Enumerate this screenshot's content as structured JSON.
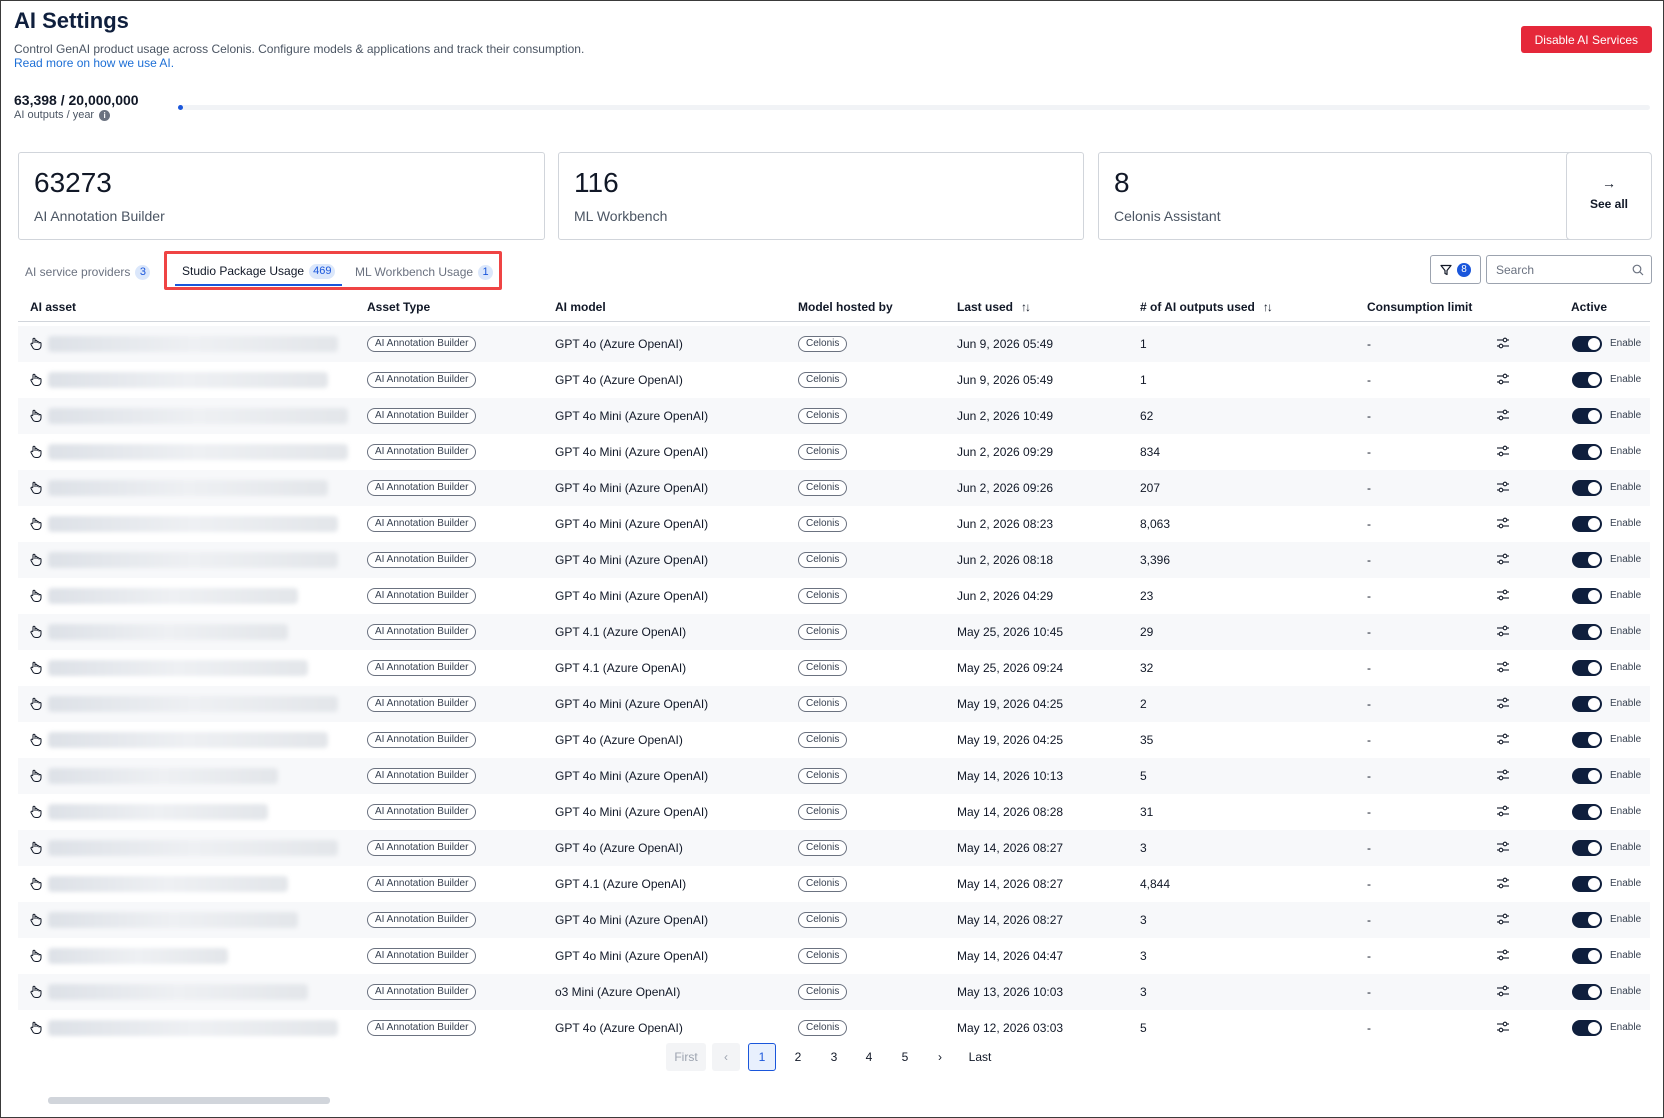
{
  "header": {
    "title": "AI Settings",
    "subtitle": "Control GenAI product usage across Celonis. Configure models & applications and track their consumption.",
    "read_more": "Read more on how we use AI.",
    "disable_button": "Disable AI Services"
  },
  "usage": {
    "count": "63,398 / 20,000,000",
    "label": "AI outputs / year",
    "used_fraction": 0.00317
  },
  "cards": [
    {
      "value": "63273",
      "label": "AI Annotation Builder"
    },
    {
      "value": "116",
      "label": "ML Workbench"
    },
    {
      "value": "8",
      "label": "Celonis Assistant"
    }
  ],
  "see_all": "See all",
  "tabs": [
    {
      "label": "AI service providers",
      "count": "3"
    },
    {
      "label": "Studio Package Usage",
      "count": "469"
    },
    {
      "label": "ML Workbench Usage",
      "count": "1"
    }
  ],
  "filter": {
    "count": "8"
  },
  "search": {
    "placeholder": "Search"
  },
  "columns": {
    "asset": "AI asset",
    "type": "Asset Type",
    "model": "AI model",
    "host": "Model hosted by",
    "last_used": "Last used",
    "outputs": "# of AI outputs used",
    "limit": "Consumption limit",
    "active": "Active"
  },
  "rows": [
    {
      "type": "AI Annotation Builder",
      "model": "GPT 4o (Azure OpenAI)",
      "host": "Celonis",
      "last_used": "Jun 9, 2026 05:49",
      "outputs": "1",
      "limit": "-",
      "status": "Enable"
    },
    {
      "type": "AI Annotation Builder",
      "model": "GPT 4o (Azure OpenAI)",
      "host": "Celonis",
      "last_used": "Jun 9, 2026 05:49",
      "outputs": "1",
      "limit": "-",
      "status": "Enable"
    },
    {
      "type": "AI Annotation Builder",
      "model": "GPT 4o Mini (Azure OpenAI)",
      "host": "Celonis",
      "last_used": "Jun 2, 2026 10:49",
      "outputs": "62",
      "limit": "-",
      "status": "Enable"
    },
    {
      "type": "AI Annotation Builder",
      "model": "GPT 4o Mini (Azure OpenAI)",
      "host": "Celonis",
      "last_used": "Jun 2, 2026 09:29",
      "outputs": "834",
      "limit": "-",
      "status": "Enable"
    },
    {
      "type": "AI Annotation Builder",
      "model": "GPT 4o Mini (Azure OpenAI)",
      "host": "Celonis",
      "last_used": "Jun 2, 2026 09:26",
      "outputs": "207",
      "limit": "-",
      "status": "Enable"
    },
    {
      "type": "AI Annotation Builder",
      "model": "GPT 4o Mini (Azure OpenAI)",
      "host": "Celonis",
      "last_used": "Jun 2, 2026 08:23",
      "outputs": "8,063",
      "limit": "-",
      "status": "Enable"
    },
    {
      "type": "AI Annotation Builder",
      "model": "GPT 4o Mini (Azure OpenAI)",
      "host": "Celonis",
      "last_used": "Jun 2, 2026 08:18",
      "outputs": "3,396",
      "limit": "-",
      "status": "Enable"
    },
    {
      "type": "AI Annotation Builder",
      "model": "GPT 4o Mini (Azure OpenAI)",
      "host": "Celonis",
      "last_used": "Jun 2, 2026 04:29",
      "outputs": "23",
      "limit": "-",
      "status": "Enable"
    },
    {
      "type": "AI Annotation Builder",
      "model": "GPT 4.1 (Azure OpenAI)",
      "host": "Celonis",
      "last_used": "May 25, 2026 10:45",
      "outputs": "29",
      "limit": "-",
      "status": "Enable"
    },
    {
      "type": "AI Annotation Builder",
      "model": "GPT 4.1 (Azure OpenAI)",
      "host": "Celonis",
      "last_used": "May 25, 2026 09:24",
      "outputs": "32",
      "limit": "-",
      "status": "Enable"
    },
    {
      "type": "AI Annotation Builder",
      "model": "GPT 4o Mini (Azure OpenAI)",
      "host": "Celonis",
      "last_used": "May 19, 2026 04:25",
      "outputs": "2",
      "limit": "-",
      "status": "Enable"
    },
    {
      "type": "AI Annotation Builder",
      "model": "GPT 4o (Azure OpenAI)",
      "host": "Celonis",
      "last_used": "May 19, 2026 04:25",
      "outputs": "35",
      "limit": "-",
      "status": "Enable"
    },
    {
      "type": "AI Annotation Builder",
      "model": "GPT 4o Mini (Azure OpenAI)",
      "host": "Celonis",
      "last_used": "May 14, 2026 10:13",
      "outputs": "5",
      "limit": "-",
      "status": "Enable"
    },
    {
      "type": "AI Annotation Builder",
      "model": "GPT 4o Mini (Azure OpenAI)",
      "host": "Celonis",
      "last_used": "May 14, 2026 08:28",
      "outputs": "31",
      "limit": "-",
      "status": "Enable"
    },
    {
      "type": "AI Annotation Builder",
      "model": "GPT 4o (Azure OpenAI)",
      "host": "Celonis",
      "last_used": "May 14, 2026 08:27",
      "outputs": "3",
      "limit": "-",
      "status": "Enable"
    },
    {
      "type": "AI Annotation Builder",
      "model": "GPT 4.1 (Azure OpenAI)",
      "host": "Celonis",
      "last_used": "May 14, 2026 08:27",
      "outputs": "4,844",
      "limit": "-",
      "status": "Enable"
    },
    {
      "type": "AI Annotation Builder",
      "model": "GPT 4o Mini (Azure OpenAI)",
      "host": "Celonis",
      "last_used": "May 14, 2026 08:27",
      "outputs": "3",
      "limit": "-",
      "status": "Enable"
    },
    {
      "type": "AI Annotation Builder",
      "model": "GPT 4o Mini (Azure OpenAI)",
      "host": "Celonis",
      "last_used": "May 14, 2026 04:47",
      "outputs": "3",
      "limit": "-",
      "status": "Enable"
    },
    {
      "type": "AI Annotation Builder",
      "model": "o3 Mini (Azure OpenAI)",
      "host": "Celonis",
      "last_used": "May 13, 2026 10:03",
      "outputs": "3",
      "limit": "-",
      "status": "Enable"
    },
    {
      "type": "AI Annotation Builder",
      "model": "GPT 4o (Azure OpenAI)",
      "host": "Celonis",
      "last_used": "May 12, 2026 03:03",
      "outputs": "5",
      "limit": "-",
      "status": "Enable"
    }
  ],
  "pagination": {
    "first": "First",
    "last": "Last",
    "pages": [
      "1",
      "2",
      "3",
      "4",
      "5"
    ],
    "current": "1"
  },
  "colors": {
    "brand_navy": "#0f1f3d",
    "accent_blue": "#1a56db",
    "danger_red": "#e5283a",
    "highlight_red": "#ef4444"
  }
}
